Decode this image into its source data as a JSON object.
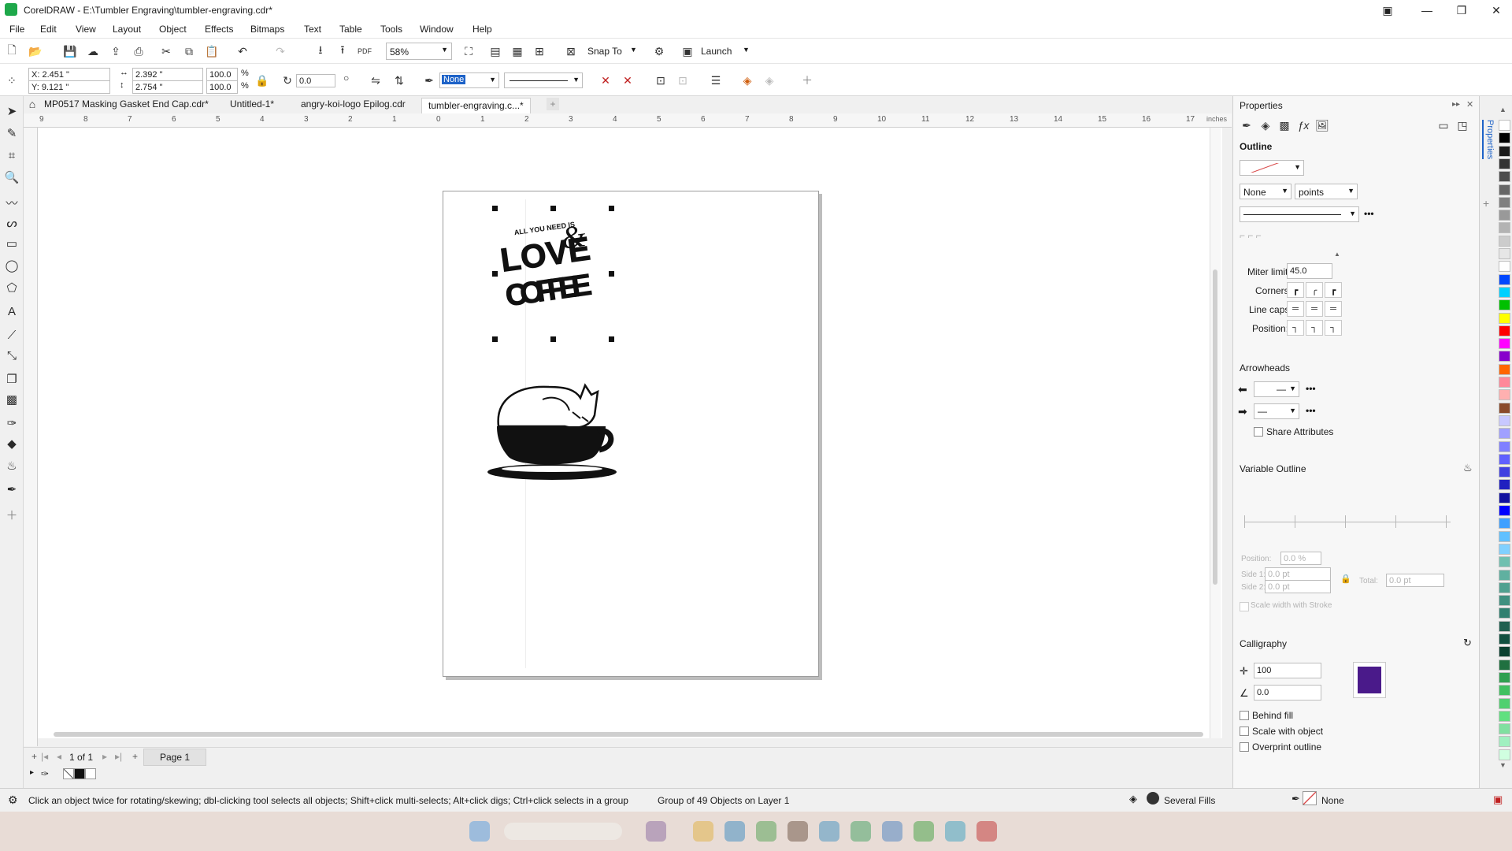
{
  "window": {
    "title": "CorelDRAW - E:\\Tumbler Engraving\\tumbler-engraving.cdr*"
  },
  "menus": [
    "File",
    "Edit",
    "View",
    "Layout",
    "Object",
    "Effects",
    "Bitmaps",
    "Text",
    "Table",
    "Tools",
    "Window",
    "Help"
  ],
  "toolbar": {
    "zoom": "58%",
    "snap_to": "Snap To",
    "launch": "Launch"
  },
  "propbar": {
    "x": "X: 2.451 \"",
    "y": "Y: 9.121 \"",
    "width": "2.392 \"",
    "height": "2.754 \"",
    "scale_w": "100.0",
    "scale_h": "100.0",
    "pct": "%",
    "rotation": "0.0",
    "outline_width": "None"
  },
  "tabs": [
    {
      "label": "MP0517 Masking Gasket End Cap.cdr*"
    },
    {
      "label": "Untitled-1*"
    },
    {
      "label": "angry-koi-logo Epilog.cdr"
    },
    {
      "label": "tumbler-engraving.c...*"
    }
  ],
  "ruler": {
    "unit": "inches",
    "h_ticks": [
      "9",
      "8",
      "7",
      "6",
      "5",
      "4",
      "3",
      "2",
      "1",
      "0",
      "1",
      "2",
      "3",
      "4",
      "5",
      "6",
      "7",
      "8",
      "9",
      "10",
      "11",
      "12",
      "13",
      "14",
      "15",
      "16",
      "17"
    ]
  },
  "artwork": {
    "logo_small": "ALL YOU NEED IS",
    "logo_love": "LOVE",
    "logo_amp": "&",
    "logo_coffee": "COFFEE"
  },
  "pagenav": {
    "count": "1 of 1",
    "page_tab": "Page 1"
  },
  "status": {
    "hint": "Click an object twice for rotating/skewing; dbl-clicking tool selects all objects; Shift+click multi-selects; Alt+click digs; Ctrl+click selects in a group",
    "selection": "Group of 49 Objects on Layer 1",
    "fill": "Several Fills",
    "outline": "None"
  },
  "properties": {
    "title": "Properties",
    "side_tab": "Properties",
    "outline_header": "Outline",
    "width_value": "None",
    "width_units": "points",
    "miter_label": "Miter limit:",
    "miter_value": "45.0",
    "corners_label": "Corners:",
    "linecaps_label": "Line caps:",
    "position_label": "Position:",
    "arrowheads": "Arrowheads",
    "share_attributes": "Share Attributes",
    "variable_outline": "Variable Outline",
    "position_field_label": "Position:",
    "position_field_value": "0.0 %",
    "side1_label": "Side 1:",
    "side1_value": "0.0 pt",
    "side2_label": "Side 2:",
    "side2_value": "0.0 pt",
    "total_label": "Total:",
    "total_value": "0.0 pt",
    "scale_width_stroke": "Scale width with Stroke",
    "calligraphy": "Calligraphy",
    "stretch_value": "100",
    "angle_value": "0.0",
    "swatch_color": "#4a1a8a",
    "behind_fill": "Behind fill",
    "scale_with_object": "Scale with object",
    "overprint_outline": "Overprint outline"
  },
  "palette": [
    "#ffffff",
    "#000000",
    "#1a1a1a",
    "#333333",
    "#4d4d4d",
    "#666666",
    "#808080",
    "#999999",
    "#b3b3b3",
    "#cccccc",
    "#e6e6e6",
    "#ffffff",
    "#0047ff",
    "#00d0ff",
    "#00c000",
    "#ffff00",
    "#ff0000",
    "#ff00ff",
    "#8800cc",
    "#ff6600",
    "#ff8899",
    "#ffb0b0",
    "#8a4a2a",
    "#c8c8ff",
    "#a0a0ff",
    "#8080ff",
    "#6060ff",
    "#4040e0",
    "#2020c0",
    "#1010a0",
    "#0000ff",
    "#40a0ff",
    "#60c0ff",
    "#80d0ff",
    "#70c0b0",
    "#60b0a0",
    "#50a090",
    "#409080",
    "#308070",
    "#206050",
    "#105040",
    "#0a4030",
    "#207040",
    "#30a050",
    "#40c060",
    "#50d070",
    "#60e080",
    "#80e0a0",
    "#a0f0c0",
    "#d0ffe0"
  ]
}
